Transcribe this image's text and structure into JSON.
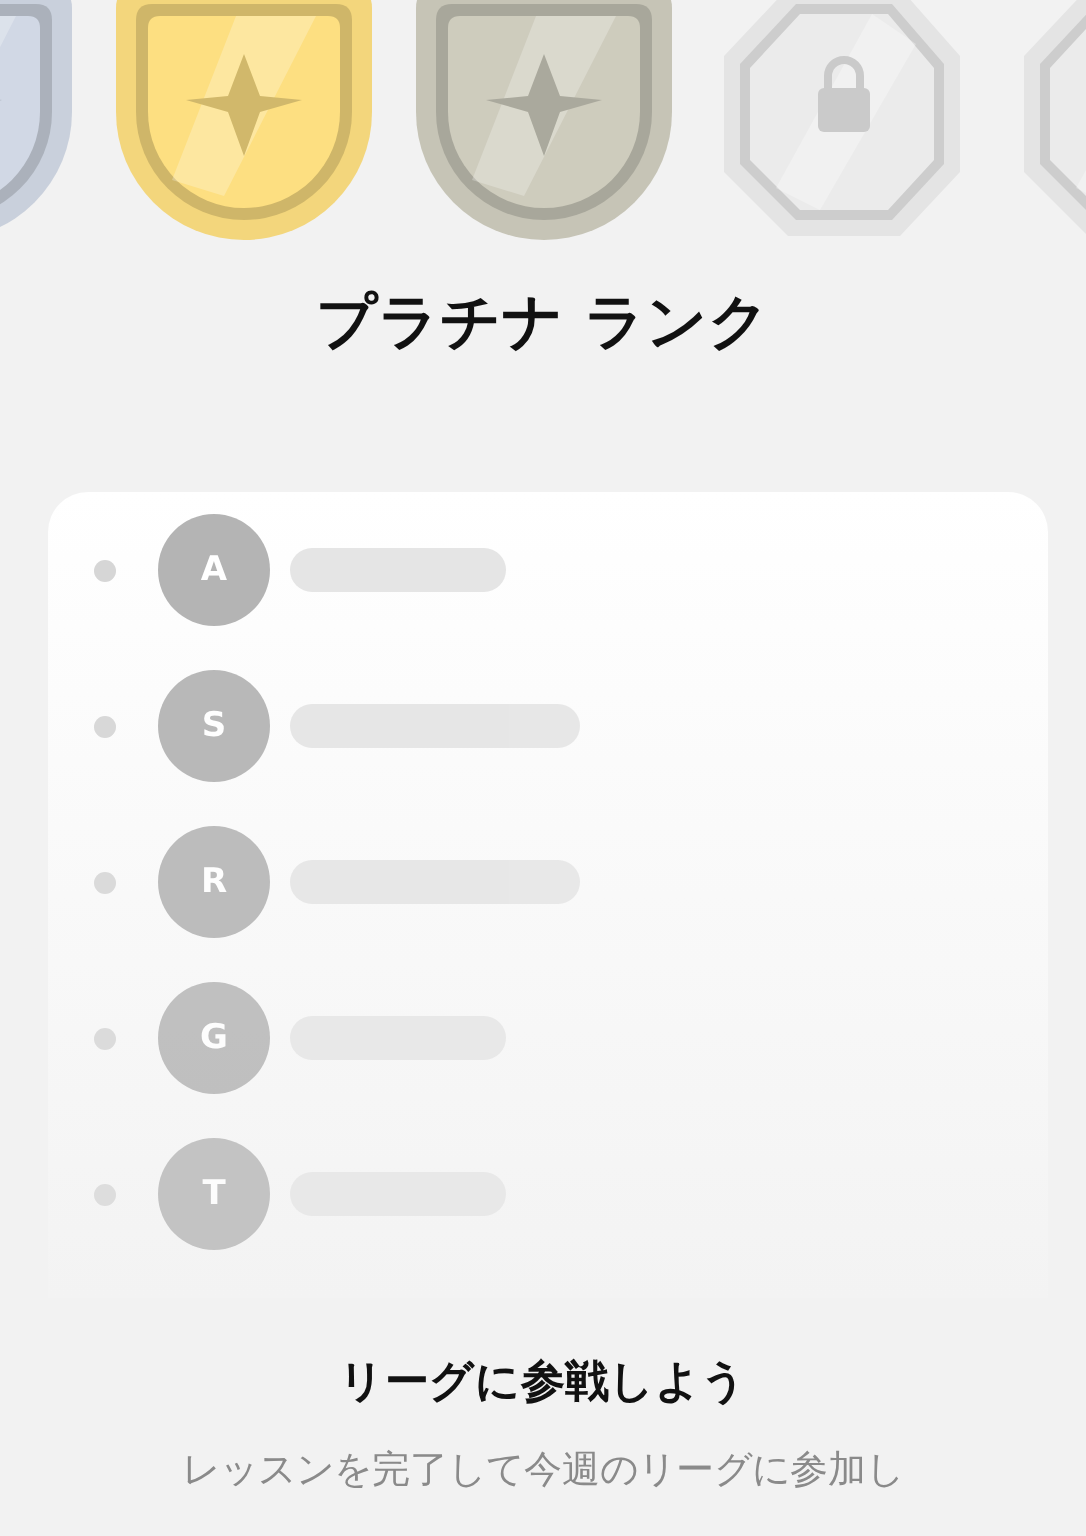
{
  "badges": [
    {
      "kind": "shield",
      "color": "#c9d0dc"
    },
    {
      "kind": "shield",
      "color": "#f3d67c"
    },
    {
      "kind": "shield",
      "color": "#c6c4b6"
    },
    {
      "kind": "locked"
    },
    {
      "kind": "locked"
    }
  ],
  "rank_title": "プラチナ ランク",
  "leaderboard": [
    {
      "initial": "A",
      "kind": "short"
    },
    {
      "initial": "S",
      "kind": "long"
    },
    {
      "initial": "R",
      "kind": "long"
    },
    {
      "initial": "G",
      "kind": "short"
    },
    {
      "initial": "T",
      "kind": "short"
    }
  ],
  "prompt": {
    "title": "リーグに参戦しよう",
    "subtitle": "レッスンを完了して今週のリーグに参加し"
  }
}
